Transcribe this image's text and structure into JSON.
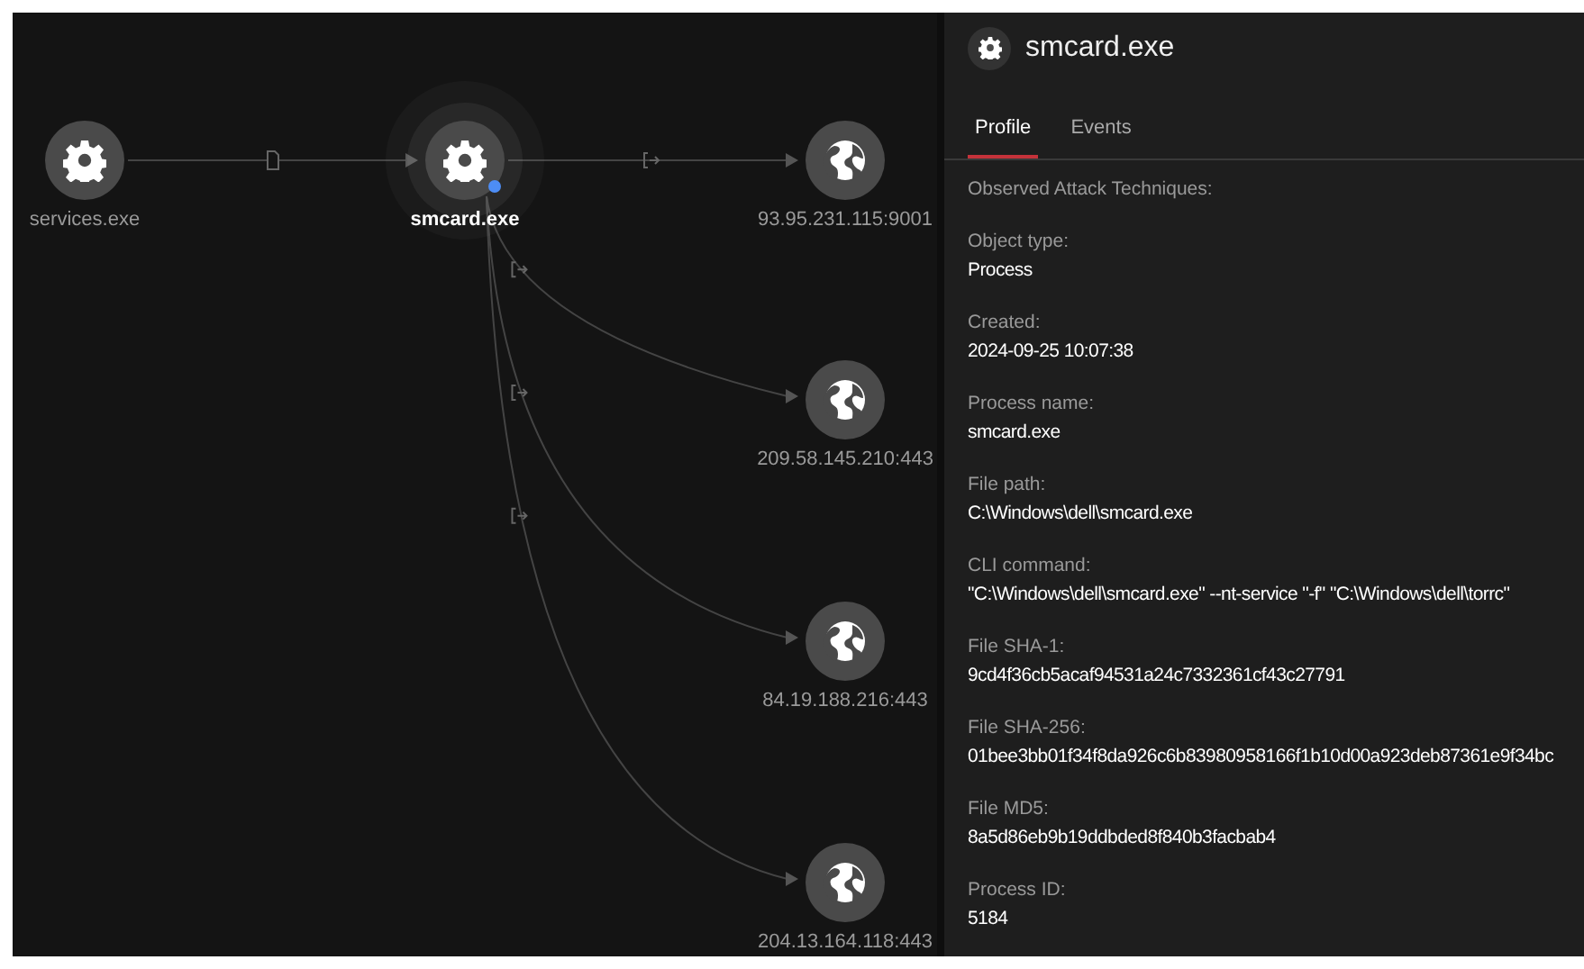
{
  "graph": {
    "nodes": [
      {
        "kind": "process",
        "label": "services.exe",
        "selected": false,
        "flagged": false
      },
      {
        "kind": "process",
        "label": "smcard.exe",
        "selected": true,
        "flagged": true
      },
      {
        "kind": "network",
        "label": "93.95.231.115:9001",
        "selected": false,
        "flagged": false
      },
      {
        "kind": "network",
        "label": "209.58.145.210:443",
        "selected": false,
        "flagged": false
      },
      {
        "kind": "network",
        "label": "84.19.188.216:443",
        "selected": false,
        "flagged": false
      },
      {
        "kind": "network",
        "label": "204.13.164.118:443",
        "selected": false,
        "flagged": false
      }
    ],
    "edges": [
      {
        "kind": "file"
      },
      {
        "kind": "connect"
      },
      {
        "kind": "connect"
      },
      {
        "kind": "connect"
      },
      {
        "kind": "connect"
      }
    ]
  },
  "panel": {
    "title": "smcard.exe",
    "tabs": [
      {
        "label": "Profile",
        "selected": true
      },
      {
        "label": "Events",
        "selected": false
      }
    ],
    "fields": [
      {
        "label": "Observed Attack Techniques:"
      },
      {
        "label": "Object type:",
        "value": "Process"
      },
      {
        "label": "Created:",
        "value": "2024-09-25 10:07:38"
      },
      {
        "label": "Process name:",
        "value": "smcard.exe"
      },
      {
        "label": "File path:",
        "value": "C:\\Windows\\dell\\smcard.exe"
      },
      {
        "label": "CLI command:",
        "value": "\"C:\\Windows\\dell\\smcard.exe\" --nt-service \"-f\" \"C:\\Windows\\dell\\torrc\""
      },
      {
        "label": "File SHA-1:",
        "value": "9cd4f36cb5acaf94531a24c7332361cf43c27791"
      },
      {
        "label": "File SHA-256:",
        "value": "01bee3bb01f34f8da926c6b83980958166f1b10d00a923deb87361e9f34bc"
      },
      {
        "label": "File MD5:",
        "value": "8a5d86eb9b19ddbded8f840b3facbab4"
      },
      {
        "label": "Process ID:",
        "value": "5184"
      }
    ]
  }
}
